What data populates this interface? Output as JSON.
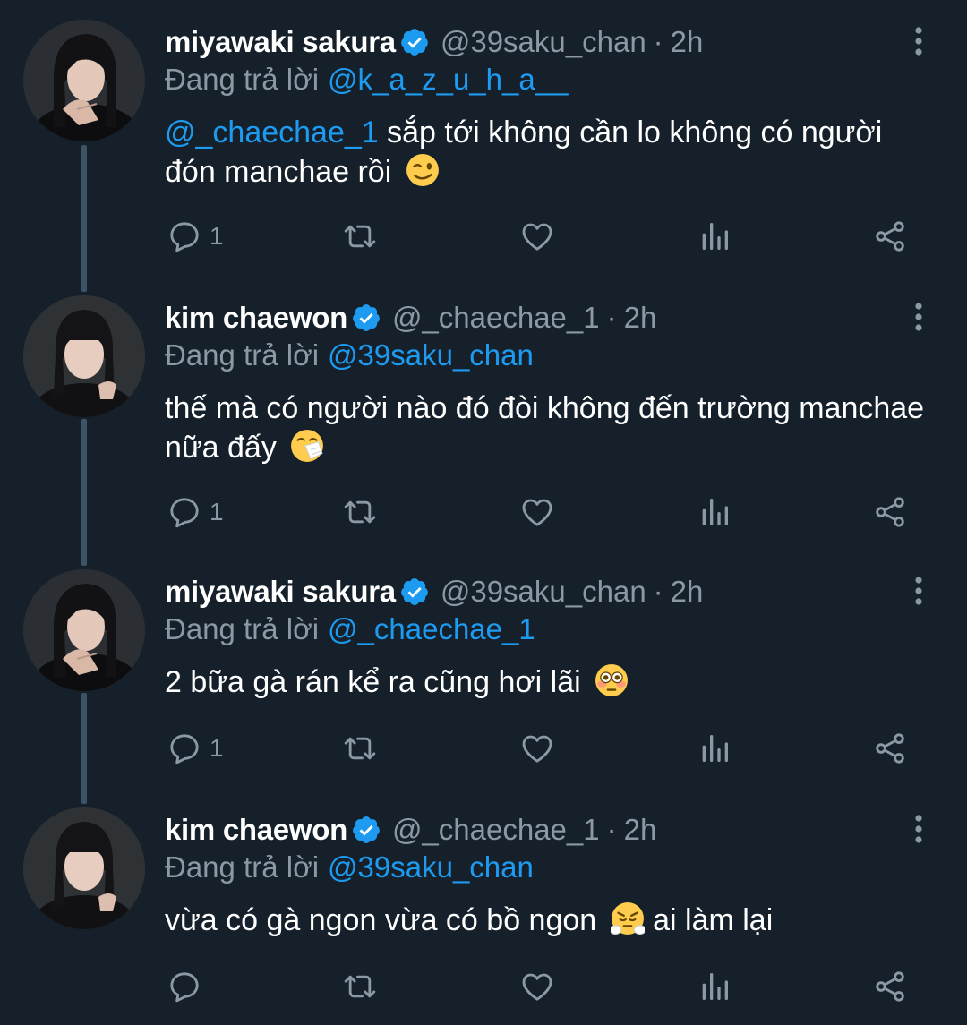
{
  "colors": {
    "background": "#15202b",
    "accent": "#1d9bf0",
    "muted": "#8b98a5",
    "text": "#ffffff",
    "thread_line": "#3d5466"
  },
  "replying_label": "Đang trả lời",
  "icons": {
    "verified": "verified-badge-icon",
    "more": "more-vertical-icon",
    "reply": "reply-icon",
    "retweet": "retweet-icon",
    "like": "heart-icon",
    "views": "analytics-icon",
    "share": "share-icon"
  },
  "tweets": [
    {
      "name": "miyawaki sakura",
      "handle": "@39saku_chan",
      "separator": "·",
      "time": "2h",
      "replying_to": "@k_a_z_u_h_a__",
      "mention": "@_chaechae_1",
      "text": " sắp tới không cần lo không có người đón manchae rồi",
      "emoji": "winking-face",
      "reply_count": "1"
    },
    {
      "name": "kim chaewon",
      "handle": "@_chaechae_1",
      "separator": "·",
      "time": "2h",
      "replying_to": "@39saku_chan",
      "text": "thế mà có người nào đó đòi không đến trường manchae nữa đấy",
      "emoji": "sneezing-face",
      "reply_count": "1"
    },
    {
      "name": "miyawaki sakura",
      "handle": "@39saku_chan",
      "separator": "·",
      "time": "2h",
      "replying_to": "@_chaechae_1",
      "text": "2 bữa gà rán kể ra cũng hơi lãi",
      "emoji": "flushed-face",
      "reply_count": "1"
    },
    {
      "name": "kim chaewon",
      "handle": "@_chaechae_1",
      "separator": "·",
      "time": "2h",
      "replying_to": "@39saku_chan",
      "text": "vừa có gà ngon vừa có bồ ngon",
      "text_after_emoji": " ai làm lại",
      "emoji": "face-with-steam-from-nose",
      "reply_count": ""
    }
  ]
}
